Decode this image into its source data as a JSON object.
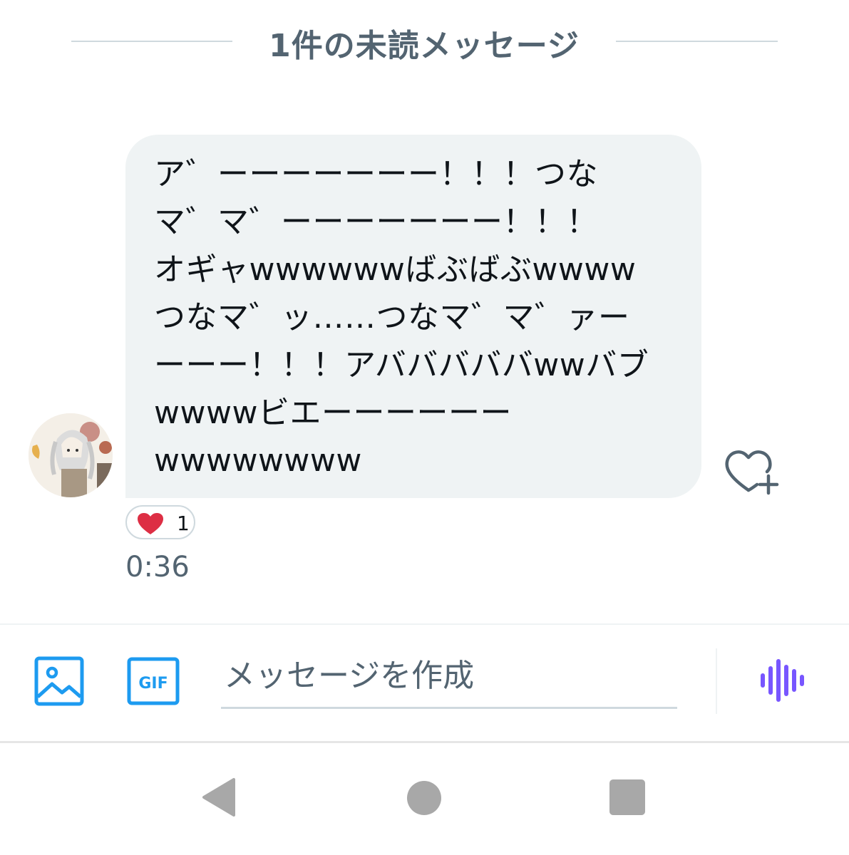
{
  "divider": {
    "label": "1件の未読メッセージ"
  },
  "message": {
    "lines": [
      "ア゛ーーーーーーー！！！つな",
      "マ゛マ゛ーーーーーーー！！！",
      "オギャwwwwwwばぶばぶwwww",
      "つなマ゛ッ……つなマ゛マ゛ァー",
      "ーーー！！！アバババババwwバブ",
      "wwwwビエーーーーーー",
      "wwwwwwww"
    ],
    "reaction": {
      "emoji": "heart",
      "count": "1"
    },
    "timestamp": "0:36"
  },
  "icons": {
    "avatar": "user-avatar",
    "add_reaction": "heart-plus-icon",
    "reaction": "heart-icon",
    "image": "image-icon",
    "gif": "gif-icon",
    "voice": "voice-wave-icon",
    "nav_back": "back-triangle-icon",
    "nav_home": "home-circle-icon",
    "nav_recents": "recents-square-icon"
  },
  "composer": {
    "placeholder": "メッセージを作成",
    "gif_label": "GIF"
  },
  "colors": {
    "accent": "#1d9bf0",
    "voice": "#7856ff",
    "heart": "#f91880",
    "bubble": "#eff3f4",
    "secondary_text": "#536471",
    "nav_icon": "#a8a8a8"
  }
}
